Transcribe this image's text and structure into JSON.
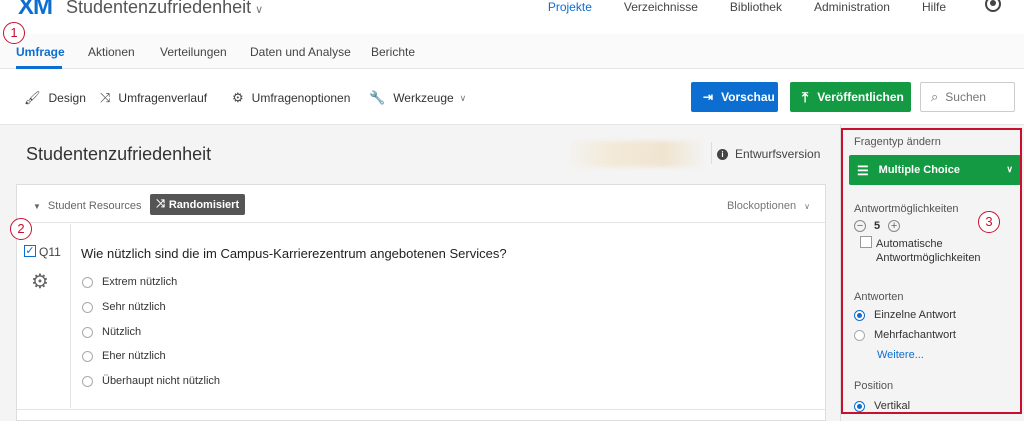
{
  "topnav": {
    "logo": "XM",
    "project_title": "Studentenzufriedenheit",
    "links": [
      "Projekte",
      "Verzeichnisse",
      "Bibliothek",
      "Administration",
      "Hilfe"
    ]
  },
  "tabs": [
    "Umfrage",
    "Aktionen",
    "Verteilungen",
    "Daten und Analyse",
    "Berichte"
  ],
  "toolbar": {
    "design": "Design",
    "history": "Umfragenverlauf",
    "options": "Umfragenoptionen",
    "tools": "Werkzeuge",
    "preview": "Vorschau",
    "publish": "Veröffentlichen",
    "search": "Suchen"
  },
  "editor": {
    "title": "Studentenzufriedenheit",
    "draft": "Entwurfsversion",
    "block": {
      "name": "Student Resources",
      "badge": "Randomisiert",
      "options": "Blockoptionen"
    },
    "question": {
      "number": "Q11",
      "text": "Wie nützlich sind die im Campus-Karrierezentrum angebotenen Services?",
      "choices": [
        "Extrem nützlich",
        "Sehr nützlich",
        "Nützlich",
        "Eher nützlich",
        "Überhaupt nicht nützlich"
      ]
    }
  },
  "panel": {
    "change_type_label": "Fragentyp ändern",
    "question_type": "Multiple Choice",
    "choices_label": "Antwortmöglichkeiten",
    "choices_count": "5",
    "auto_choices": "Automatische Antwortmöglichkeiten",
    "answers_label": "Antworten",
    "single_answer": "Einzelne Antwort",
    "multi_answer": "Mehrfachantwort",
    "more": "Weitere...",
    "position_label": "Position",
    "vertical": "Vertikal"
  },
  "callouts": [
    "1",
    "2",
    "3"
  ],
  "colors": {
    "accent_blue": "#0b6ed0",
    "publish_green": "#139a43",
    "callout_red": "#c8102e"
  }
}
